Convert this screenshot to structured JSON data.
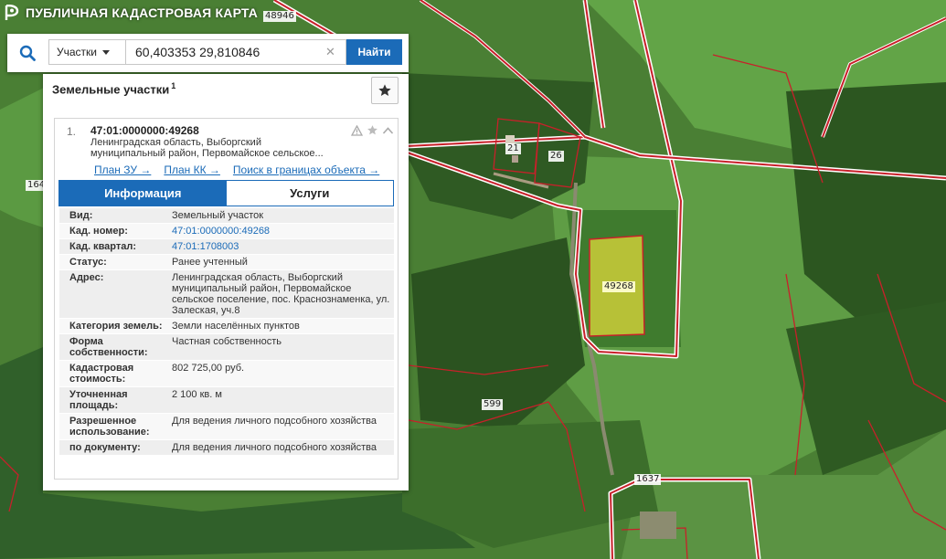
{
  "app": {
    "title": "ПУБЛИЧНАЯ КАДАСТРОВАЯ КАРТА"
  },
  "search": {
    "search_icon": "search-icon",
    "type_label": "Участки",
    "query": "60,403353 29,810846",
    "clear_icon": "close-icon",
    "find_label": "Найти"
  },
  "panel": {
    "title": "Земельные участки",
    "count": "1",
    "favorite_icon": "star-icon",
    "result": {
      "index": "1.",
      "cad_number": "47:01:0000000:49268",
      "address_short": "Ленинградская область, Выборгский муниципальный район, Первомайское сельское...",
      "tool_icons": [
        "warning-icon",
        "star-icon",
        "collapse-icon"
      ],
      "links": [
        "План ЗУ →",
        "План КК →",
        "Поиск в границах объекта →"
      ],
      "tabs": {
        "info": "Информация",
        "services": "Услуги"
      },
      "rows": [
        {
          "key": "Вид:",
          "value": "Земельный участок"
        },
        {
          "key": "Кад. номер:",
          "value": "47:01:0000000:49268",
          "link": true
        },
        {
          "key": "Кад. квартал:",
          "value": "47:01:1708003",
          "link": true
        },
        {
          "key": "Статус:",
          "value": "Ранее учтенный"
        },
        {
          "key": "Адрес:",
          "value": "Ленинградская область, Выборгский муниципальный район, Первомайское сельское поселение, пос. Краснознаменка, ул. Залеская, уч.8"
        },
        {
          "key": "Категория земель:",
          "value": "Земли населённых пунктов"
        },
        {
          "key": "Форма собственности:",
          "value": "Частная собственность"
        },
        {
          "key": "Кадастровая стоимость:",
          "value": "802 725,00 руб."
        },
        {
          "key": "Уточненная площадь:",
          "value": "2 100 кв. м"
        },
        {
          "key": "Разрешенное использование:",
          "value": "Для ведения личного подсобного хозяйства"
        },
        {
          "key": "по документу:",
          "value": "Для ведения личного подсобного хозяйства"
        }
      ]
    }
  },
  "map": {
    "labels": [
      "48946",
      "164",
      "21",
      "26",
      "49268",
      "599",
      "1637"
    ],
    "colors": {
      "boundary": "#c8202a",
      "selected_fill": "#e6dc3c",
      "panel_accent": "#1b6bb8"
    }
  }
}
